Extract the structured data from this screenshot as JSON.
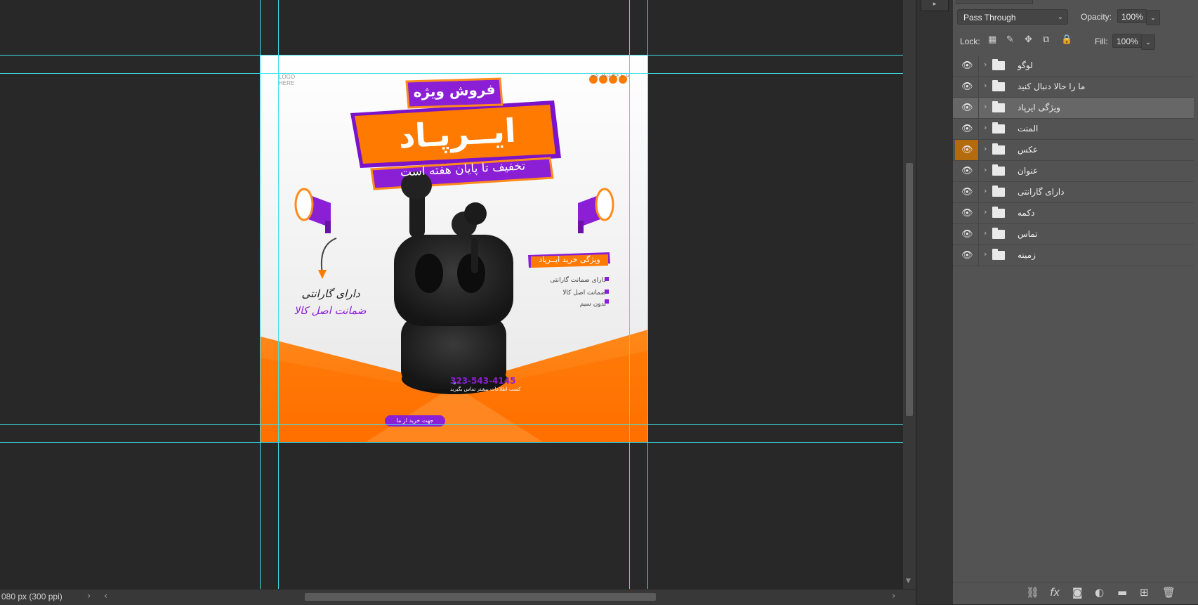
{
  "document": {
    "status_text": "080 px (300 ppi)"
  },
  "layers_panel": {
    "blend_mode": "Pass Through",
    "opacity_label": "Opacity:",
    "opacity_value": "100%",
    "lock_label": "Lock:",
    "fill_label": "Fill:",
    "fill_value": "100%",
    "layers": [
      {
        "name": "لوگو",
        "selected": false,
        "highlight_eye": false
      },
      {
        "name": "ما را حالا دنبال کنید",
        "selected": false,
        "highlight_eye": false
      },
      {
        "name": "ویژگی ایرپاد",
        "selected": true,
        "highlight_eye": false
      },
      {
        "name": "المنت",
        "selected": false,
        "highlight_eye": false
      },
      {
        "name": "عکس",
        "selected": false,
        "highlight_eye": true
      },
      {
        "name": "عنوان",
        "selected": false,
        "highlight_eye": false
      },
      {
        "name": "دارای گارانتی",
        "selected": false,
        "highlight_eye": false
      },
      {
        "name": "دکمه",
        "selected": false,
        "highlight_eye": false
      },
      {
        "name": "تماس",
        "selected": false,
        "highlight_eye": false
      },
      {
        "name": "زمینه",
        "selected": false,
        "highlight_eye": false
      }
    ]
  },
  "design": {
    "logo_text_1": "LOGO",
    "logo_text_2": "HERE",
    "follow_text": "ما را حالا دنبال کنید",
    "badge_text": "فروش ویژه",
    "title_text": "ایــرپـاد",
    "subtitle_text": "تخفیف تا پایان هفته است",
    "feature_title": "ویژگی خرید ایــرپاد",
    "features": [
      "دارای ضمانت گارانتی",
      "ضمانت اصل کالا",
      "بدون سیم"
    ],
    "guarantee_1": "دارای گارانتی",
    "guarantee_2": "ضمانت اصل کالا",
    "phone": "323-543-4145",
    "contact_text": "کسب اطلاعات بیشتر تماس بگیرید",
    "buy_button": "جهت خرید از ما",
    "colors": {
      "orange": "#ff7a00",
      "purple": "#8a1fd6",
      "canvas_bg": "#282828",
      "panel_bg": "#535353",
      "guide": "#3fe0e6"
    }
  }
}
